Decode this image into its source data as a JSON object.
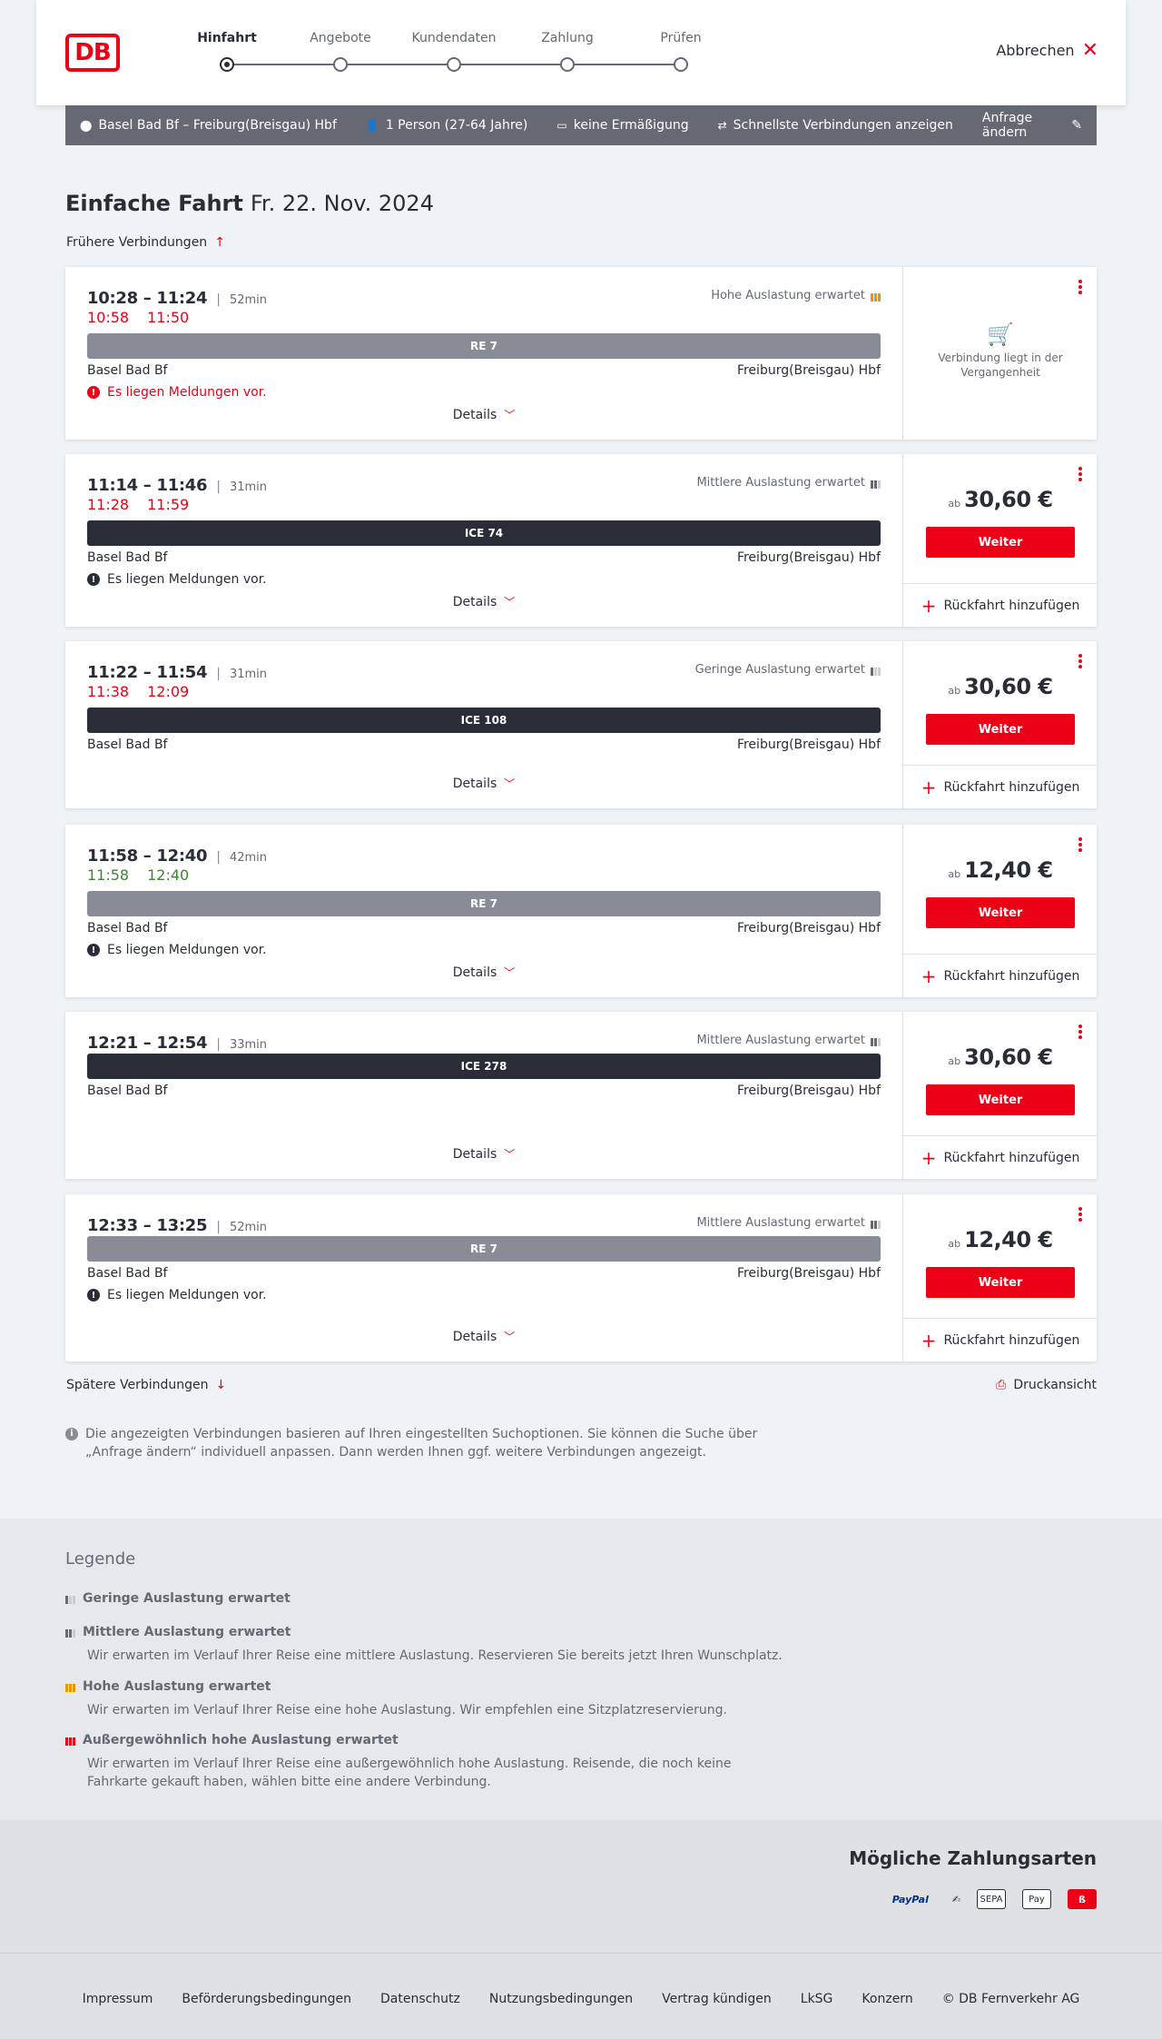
{
  "header": {
    "logo": "DB",
    "steps": [
      "Hinfahrt",
      "Angebote",
      "Kundendaten",
      "Zahlung",
      "Prüfen"
    ],
    "active_step": "Hinfahrt",
    "cancel_label": "Abbrechen"
  },
  "searchbar": {
    "route": "Basel Bad Bf – Freiburg(Breisgau) Hbf",
    "passengers": "1 Person (27-64 Jahre)",
    "discount": "keine Ermäßigung",
    "fastest": "Schnellste Verbindungen anzeigen",
    "edit": "Anfrage ändern"
  },
  "title": {
    "main": "Einfache Fahrt",
    "date": "Fr. 22. Nov. 2024"
  },
  "earlier": "Frühere Verbindungen",
  "later": "Spätere Verbindungen",
  "print": "Druckansicht",
  "details_label": "Details",
  "weiter_label": "Weiter",
  "return_label": "Rückfahrt hinzufügen",
  "price_prefix": "ab",
  "past_text": "Verbindung liegt in der Vergangenheit",
  "connections": [
    {
      "times": "10:28 – 11:24",
      "duration": "52min",
      "realtime": [
        "10:58",
        "11:50"
      ],
      "realtime_status": "late",
      "load": "Hohe Auslastung erwartet",
      "load_level": "high",
      "train": "RE 7",
      "train_type": "re",
      "from": "Basel Bad Bf",
      "to": "Freiburg(Breisgau) Hbf",
      "message": "Es liegen Meldungen vor.",
      "message_alert": true,
      "price": null,
      "past": true
    },
    {
      "times": "11:14 – 11:46",
      "duration": "31min",
      "realtime": [
        "11:28",
        "11:59"
      ],
      "realtime_status": "late",
      "load": "Mittlere Auslastung erwartet",
      "load_level": "medium",
      "train": "ICE 74",
      "train_type": "ice",
      "from": "Basel Bad Bf",
      "to": "Freiburg(Breisgau) Hbf",
      "message": "Es liegen Meldungen vor.",
      "message_alert": false,
      "price": "30,60 €",
      "past": false
    },
    {
      "times": "11:22 – 11:54",
      "duration": "31min",
      "realtime": [
        "11:38",
        "12:09"
      ],
      "realtime_status": "late",
      "load": "Geringe Auslastung erwartet",
      "load_level": "low",
      "train": "ICE 108",
      "train_type": "ice",
      "from": "Basel Bad Bf",
      "to": "Freiburg(Breisgau) Hbf",
      "message": null,
      "message_alert": false,
      "price": "30,60 €",
      "past": false
    },
    {
      "times": "11:58 – 12:40",
      "duration": "42min",
      "realtime": [
        "11:58",
        "12:40"
      ],
      "realtime_status": "ontime",
      "load": null,
      "load_level": null,
      "train": "RE 7",
      "train_type": "re",
      "from": "Basel Bad Bf",
      "to": "Freiburg(Breisgau) Hbf",
      "message": "Es liegen Meldungen vor.",
      "message_alert": false,
      "price": "12,40 €",
      "past": false
    },
    {
      "times": "12:21 – 12:54",
      "duration": "33min",
      "realtime": null,
      "realtime_status": null,
      "load": "Mittlere Auslastung erwartet",
      "load_level": "medium",
      "train": "ICE 278",
      "train_type": "ice",
      "from": "Basel Bad Bf",
      "to": "Freiburg(Breisgau) Hbf",
      "message": null,
      "message_alert": false,
      "price": "30,60 €",
      "past": false
    },
    {
      "times": "12:33 – 13:25",
      "duration": "52min",
      "realtime": null,
      "realtime_status": null,
      "load": "Mittlere Auslastung erwartet",
      "load_level": "medium",
      "train": "RE 7",
      "train_type": "re",
      "from": "Basel Bad Bf",
      "to": "Freiburg(Breisgau) Hbf",
      "message": "Es liegen Meldungen vor.",
      "message_alert": false,
      "price": "12,40 €",
      "past": false
    }
  ],
  "info_text": "Die angezeigten Verbindungen basieren auf Ihren eingestellten Suchoptionen. Sie können die Suche über „Anfrage ändern“ individuell anpassen. Dann werden Ihnen ggf. weitere Verbindungen angezeigt.",
  "legend": {
    "title": "Legende",
    "items": [
      {
        "title": "Geringe Auslastung erwartet",
        "desc": ""
      },
      {
        "title": "Mittlere Auslastung erwartet",
        "desc": "Wir erwarten im Verlauf Ihrer Reise eine mittlere Auslastung. Reservieren Sie bereits jetzt Ihren Wunschplatz."
      },
      {
        "title": "Hohe Auslastung erwartet",
        "desc": "Wir erwarten im Verlauf Ihrer Reise eine hohe Auslastung. Wir empfehlen eine Sitzplatzreservierung."
      },
      {
        "title": "Außergewöhnlich hohe Auslastung erwartet",
        "desc": "Wir erwarten im Verlauf Ihrer Reise eine außergewöhnlich hohe Auslastung. Reisende, die noch keine Fahrkarte gekauft haben, wählen bitte eine andere Verbindung."
      }
    ]
  },
  "payments": {
    "title": "Mögliche Zahlungsarten",
    "methods": [
      "PayPal",
      "Lastschrift",
      "SEPA",
      "Apple Pay",
      "DB"
    ]
  },
  "footer": [
    "Impressum",
    "Beförderungsbedingungen",
    "Datenschutz",
    "Nutzungsbedingungen",
    "Vertrag kündigen",
    "LkSG",
    "Konzern",
    "© DB Fernverkehr AG"
  ],
  "colors": {
    "accent": "#ec0016",
    "dark": "#282d37",
    "grey": "#646973",
    "ontime": "#408335",
    "high_load": "#f39200"
  }
}
